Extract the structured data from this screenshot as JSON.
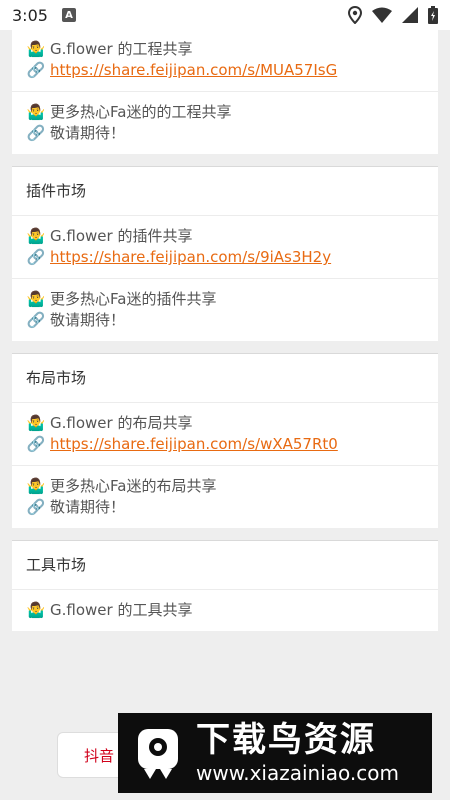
{
  "status_bar": {
    "time": "3:05",
    "notification_letter": "A"
  },
  "sections": [
    {
      "title": "",
      "items": [
        {
          "title": "G.flower 的工程共享",
          "link": "https://share.feijipan.com/s/MUA57IsG"
        },
        {
          "title": "更多热心Fa迷的的工程共享",
          "link": "敬请期待！"
        }
      ]
    },
    {
      "title": "插件市场",
      "items": [
        {
          "title": "G.flower 的插件共享",
          "link": "https://share.feijipan.com/s/9iAs3H2y"
        },
        {
          "title": "更多热心Fa迷的插件共享",
          "link": "敬请期待！"
        }
      ]
    },
    {
      "title": "布局市场",
      "items": [
        {
          "title": "G.flower 的布局共享",
          "link": "https://share.feijipan.com/s/wXA57Rt0"
        },
        {
          "title": "更多热心Fa迷的布局共享",
          "link": "敬请期待！"
        }
      ]
    },
    {
      "title": "工具市场",
      "items": [
        {
          "title": "G.flower 的工具共享",
          "link": ""
        }
      ]
    }
  ],
  "bottom": {
    "douyin_label": "抖音"
  },
  "watermark": {
    "title": "下载鸟资源",
    "url": "www.xiazainiao.com"
  },
  "colors": {
    "link": "#e86a12",
    "douyin": "#d0021b"
  }
}
